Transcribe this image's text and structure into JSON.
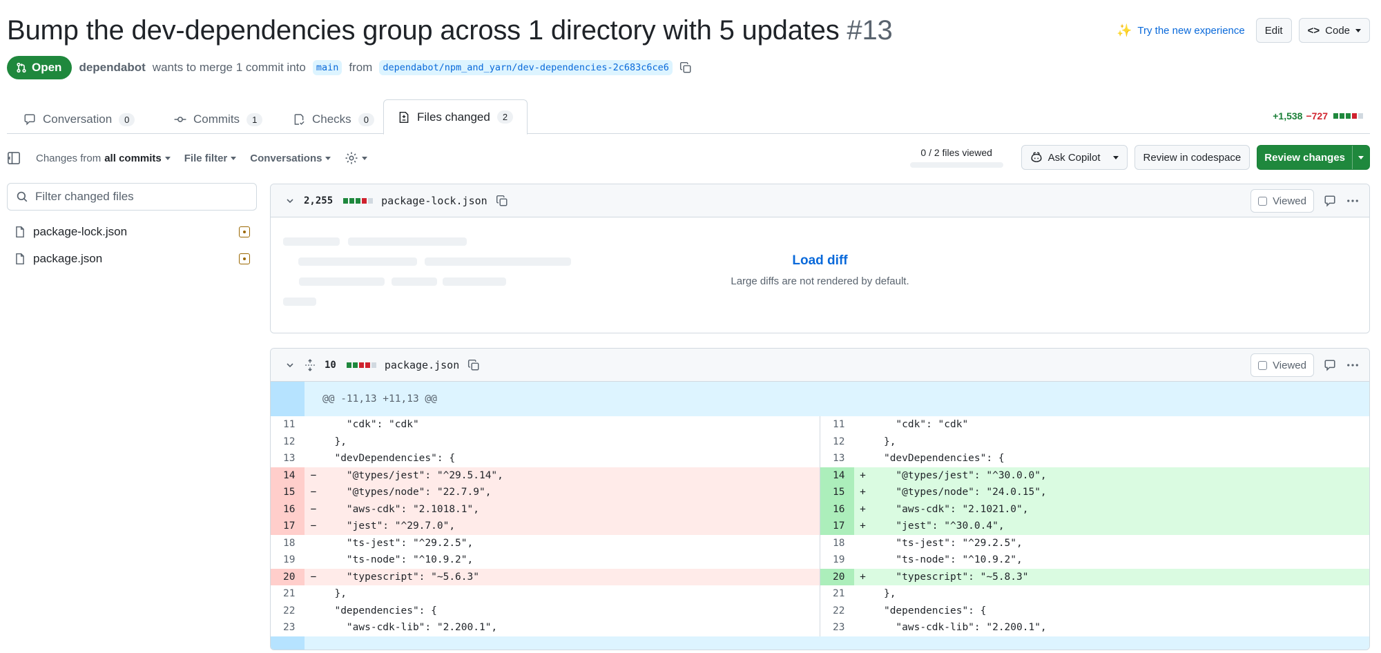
{
  "pr": {
    "title": "Bump the dev-dependencies group across 1 directory with 5 updates",
    "number": "#13",
    "state": "Open",
    "author": "dependabot",
    "merge_text": "wants to merge 1 commit into",
    "base_branch": "main",
    "from_text": "from",
    "head_branch": "dependabot/npm_and_yarn/dev-dependencies-2c683c6ce6"
  },
  "header": {
    "try_new": "Try the new experience",
    "edit": "Edit",
    "code": "Code"
  },
  "tabs": [
    {
      "label": "Conversation",
      "count": "0"
    },
    {
      "label": "Commits",
      "count": "1"
    },
    {
      "label": "Checks",
      "count": "0"
    },
    {
      "label": "Files changed",
      "count": "2"
    }
  ],
  "diffstat": {
    "additions": "+1,538",
    "deletions": "−727"
  },
  "toolbar": {
    "changes_from": "Changes from",
    "all_commits": "all commits",
    "file_filter": "File filter",
    "conversations": "Conversations",
    "files_viewed": "0 / 2 files viewed",
    "ask_copilot": "Ask Copilot",
    "review_codespace": "Review in codespace",
    "review_changes": "Review changes"
  },
  "sidebar": {
    "filter_placeholder": "Filter changed files",
    "files": [
      "package-lock.json",
      "package.json"
    ]
  },
  "files": [
    {
      "count": "2,255",
      "name": "package-lock.json",
      "viewed": "Viewed",
      "load_diff": "Load diff",
      "load_diff_note": "Large diffs are not rendered by default."
    },
    {
      "count": "10",
      "name": "package.json",
      "viewed": "Viewed",
      "hunk": "@@ -11,13 +11,13 @@"
    }
  ],
  "diff_rows": [
    {
      "type": "ctx",
      "ln": "11",
      "rn": "11",
      "l": "    \"cdk\": \"cdk\"",
      "r": "    \"cdk\": \"cdk\""
    },
    {
      "type": "ctx",
      "ln": "12",
      "rn": "12",
      "l": "  },",
      "r": "  },"
    },
    {
      "type": "ctx",
      "ln": "13",
      "rn": "13",
      "l": "  \"devDependencies\": {",
      "r": "  \"devDependencies\": {"
    },
    {
      "type": "chg",
      "ln": "14",
      "rn": "14",
      "l": "    \"@types/jest\": \"^29.5.14\",",
      "r": "    \"@types/jest\": \"^30.0.0\","
    },
    {
      "type": "chg",
      "ln": "15",
      "rn": "15",
      "l": "    \"@types/node\": \"22.7.9\",",
      "r": "    \"@types/node\": \"24.0.15\","
    },
    {
      "type": "chg",
      "ln": "16",
      "rn": "16",
      "l": "    \"aws-cdk\": \"2.1018.1\",",
      "r": "    \"aws-cdk\": \"2.1021.0\","
    },
    {
      "type": "chg",
      "ln": "17",
      "rn": "17",
      "l": "    \"jest\": \"^29.7.0\",",
      "r": "    \"jest\": \"^30.0.4\","
    },
    {
      "type": "ctx",
      "ln": "18",
      "rn": "18",
      "l": "    \"ts-jest\": \"^29.2.5\",",
      "r": "    \"ts-jest\": \"^29.2.5\","
    },
    {
      "type": "ctx",
      "ln": "19",
      "rn": "19",
      "l": "    \"ts-node\": \"^10.9.2\",",
      "r": "    \"ts-node\": \"^10.9.2\","
    },
    {
      "type": "chg",
      "ln": "20",
      "rn": "20",
      "l": "    \"typescript\": \"~5.6.3\"",
      "r": "    \"typescript\": \"~5.8.3\""
    },
    {
      "type": "ctx",
      "ln": "21",
      "rn": "21",
      "l": "  },",
      "r": "  },"
    },
    {
      "type": "ctx",
      "ln": "22",
      "rn": "22",
      "l": "  \"dependencies\": {",
      "r": "  \"dependencies\": {"
    },
    {
      "type": "ctx",
      "ln": "23",
      "rn": "23",
      "l": "    \"aws-cdk-lib\": \"2.200.1\",",
      "r": "    \"aws-cdk-lib\": \"2.200.1\","
    }
  ],
  "markers": {
    "del": "−",
    "add": "+"
  },
  "colors": {
    "accent": "#0969da",
    "success": "#1f883d",
    "danger": "#cf222e",
    "attention": "#9a6700"
  }
}
